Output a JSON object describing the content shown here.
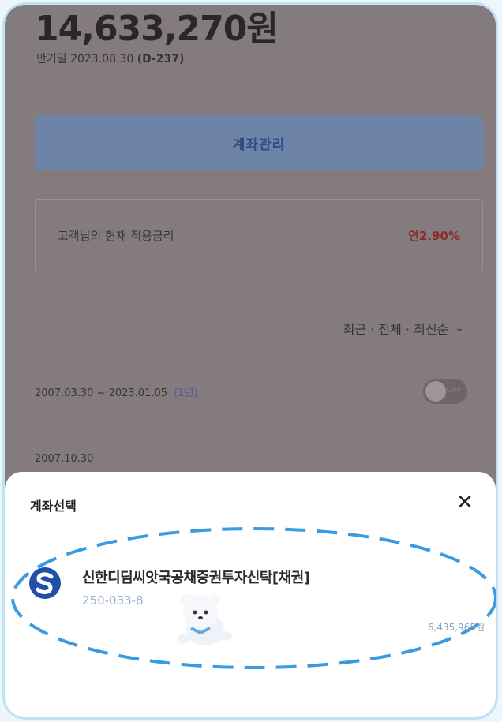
{
  "summary": {
    "balance": "14,633,270원",
    "maturity_prefix": "만기일 2023.08.30",
    "maturity_dday": "(D-237)",
    "manage_button_label": "계좌관리",
    "rate_label": "고객님의 현재 적용금리",
    "rate_value": "연2.90%"
  },
  "history": {
    "filter_label": "최근 · 전체 · 최신순",
    "period": "2007.03.30 ~ 2023.01.05",
    "period_link": "(1년)",
    "toggle_text": "OFF",
    "first_date": "2007.10.30"
  },
  "sheet": {
    "title": "계좌선택",
    "close_label": "✕",
    "account": {
      "name": "신한디딤씨앗국공채증권투자신탁[채권]",
      "number": "250-033-8",
      "balance": "6,435,965원"
    }
  },
  "colors": {
    "overlay": "#837b7e",
    "accent_dash": "#3a9be0",
    "bank_blue": "#1f4fa8"
  },
  "icons": {
    "close": "close-icon",
    "chevron": "chevron-down-icon",
    "bank": "shinhan-logo-icon",
    "mascot": "bear-mascot-icon"
  }
}
